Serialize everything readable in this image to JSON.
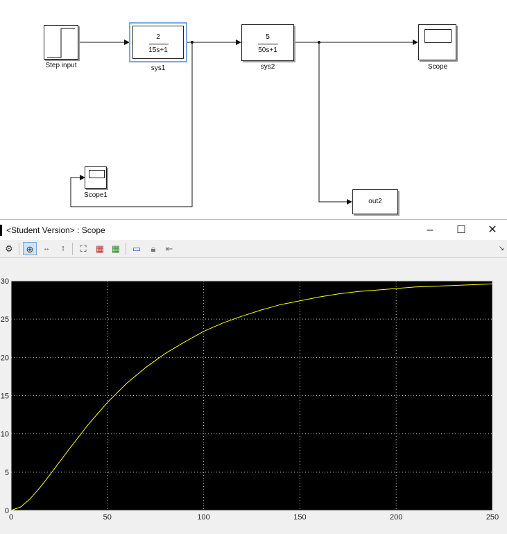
{
  "diagram": {
    "step_label": "Step input",
    "sys1": {
      "num": "2",
      "den": "15s+1",
      "label": "sys1"
    },
    "sys2": {
      "num": "5",
      "den": "50s+1",
      "label": "sys2"
    },
    "scope_label": "Scope",
    "scope1_label": "Scope1",
    "out2_text": "out2"
  },
  "window": {
    "title": "<Student Version> : Scope",
    "minimize": "–",
    "maximize": "☐",
    "close": "✕"
  },
  "toolbar_icons": [
    "gear-icon",
    "zoom-in-icon",
    "zoom-x-icon",
    "zoom-y-icon",
    "autoscale-icon",
    "save-axes-icon",
    "restore-axes-icon",
    "params-icon",
    "lock-icon",
    "signal-select-icon"
  ],
  "chart_data": {
    "type": "line",
    "xlim": [
      0,
      250
    ],
    "ylim": [
      0,
      30
    ],
    "xticks": [
      0,
      50,
      100,
      150,
      200,
      250
    ],
    "yticks": [
      0,
      5,
      10,
      15,
      20,
      25,
      30
    ],
    "x_tick_labels": [
      "0",
      "50",
      "100",
      "150",
      "200",
      "250"
    ],
    "y_tick_labels": [
      "0",
      "5",
      "10",
      "15",
      "20",
      "25",
      "30"
    ],
    "grid": true,
    "background": "#000000",
    "line_color": "#ffff00",
    "series": [
      {
        "x": [
          0,
          5,
          10,
          15,
          20,
          25,
          30,
          40,
          50,
          60,
          70,
          80,
          90,
          100,
          110,
          120,
          130,
          140,
          150,
          160,
          170,
          180,
          190,
          200,
          210,
          220,
          230,
          240,
          250
        ],
        "values": [
          0,
          0.45,
          1.55,
          2.99,
          4.6,
          6.28,
          7.96,
          11.2,
          14.1,
          16.6,
          18.7,
          20.5,
          22.0,
          23.4,
          24.5,
          25.4,
          26.2,
          26.9,
          27.4,
          27.9,
          28.3,
          28.6,
          28.8,
          29.0,
          29.2,
          29.3,
          29.4,
          29.5,
          29.6
        ]
      }
    ]
  }
}
